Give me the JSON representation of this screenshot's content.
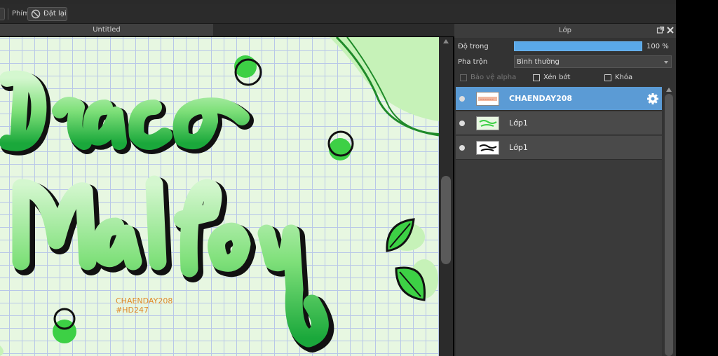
{
  "toolbar": {
    "shortcut_label": "Phím",
    "reset_label": "Đặt lại"
  },
  "document": {
    "tab_title": "Untitled",
    "watermark_line1": "CHAENDAY208",
    "watermark_line2": "#HD247"
  },
  "layers_panel": {
    "title": "Lớp",
    "opacity_label": "Độ trong",
    "opacity_value": "100 %",
    "opacity_fraction": 1.0,
    "blend_label": "Pha trộn",
    "blend_value": "Bình thường",
    "protect_alpha_label": "Bảo vệ alpha",
    "clipping_label": "Xén bớt",
    "lock_label": "Khóa",
    "layers": [
      {
        "name": "CHAENDAY208",
        "selected": true,
        "visible": true
      },
      {
        "name": "Lớp1",
        "selected": false,
        "visible": true
      },
      {
        "name": "Lớp1",
        "selected": false,
        "visible": true
      }
    ]
  },
  "colors": {
    "accent": "#5b9bd5",
    "canvas_bg": "#e7f7e1",
    "lettering_green": "#3cc95a",
    "watermark_orange": "#e08a2a"
  }
}
